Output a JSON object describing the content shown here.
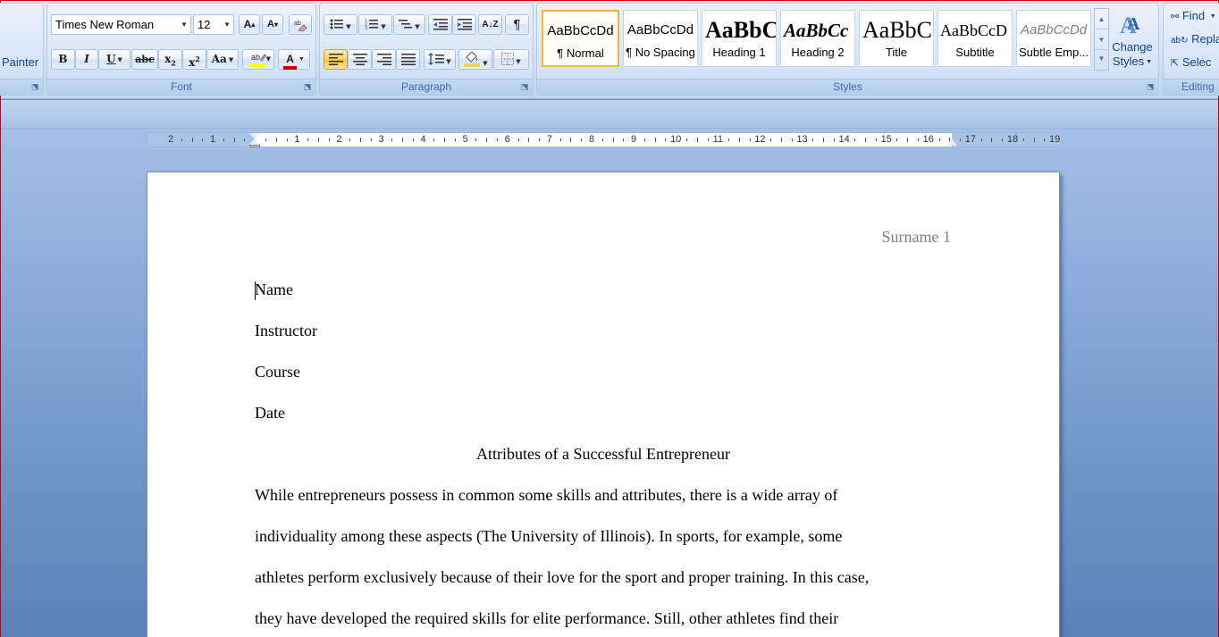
{
  "clipboard": {
    "painter_label": "Painter"
  },
  "font_group": {
    "label": "Font",
    "font_name": "Times New Roman",
    "font_size": "12",
    "buttons": {
      "grow": "A",
      "shrink": "A",
      "bold": "B",
      "italic": "I",
      "underline": "U",
      "strikethrough": "abc",
      "subscript": "x",
      "superscript": "x",
      "change_case": "Aa",
      "font_color": "A"
    }
  },
  "paragraph_group": {
    "label": "Paragraph",
    "pilcrow": "¶",
    "sort": "A↓Z"
  },
  "styles_group": {
    "label": "Styles",
    "tiles": [
      {
        "sample": "AaBbCcDd",
        "name": "¶ Normal"
      },
      {
        "sample": "AaBbCcDd",
        "name": "¶ No Spacing"
      },
      {
        "sample": "AaBbC",
        "name": "Heading 1"
      },
      {
        "sample": "AaBbCc",
        "name": "Heading 2"
      },
      {
        "sample": "AaBbC",
        "name": "Title"
      },
      {
        "sample": "AaBbCcD",
        "name": "Subtitle"
      },
      {
        "sample": "AaBbCcDd",
        "name": "Subtle Emp..."
      }
    ],
    "change_styles": {
      "line1": "Change",
      "line2": "Styles"
    }
  },
  "editing_group": {
    "label": "Editing",
    "find": "Find",
    "replace": "Repla",
    "select": "Selec"
  },
  "ruler": {
    "labels": [
      "2",
      "1",
      "",
      "1",
      "2",
      "3",
      "4",
      "5",
      "6",
      "7",
      "8",
      "9",
      "10",
      "11",
      "12",
      "13",
      "14",
      "15",
      "16",
      "17",
      "18",
      "19"
    ]
  },
  "document": {
    "header": "Surname 1",
    "lines": [
      "Name",
      "Instructor",
      "Course",
      "Date"
    ],
    "title": "Attributes of a Successful Entrepreneur",
    "body": [
      "While entrepreneurs possess in common some skills and attributes, there is a wide array of",
      "individuality among these aspects (The University of Illinois). In sports, for example, some",
      "athletes perform exclusively because of their love for the sport and proper training. In this case,",
      "they have developed the required skills for elite performance. Still, other athletes find their"
    ]
  },
  "colors": {
    "ribbon_text": "#15428b",
    "active_style_border": "#f0b63f",
    "workspace": "#6e93c6",
    "highlight": "#ffff00",
    "font_color_bar": "#c00000"
  }
}
